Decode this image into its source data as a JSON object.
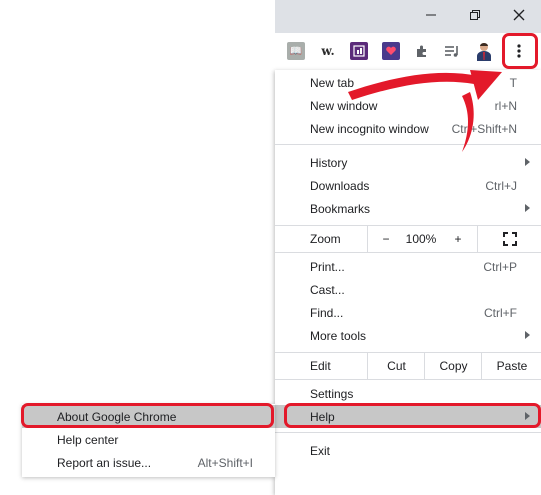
{
  "window_controls": [
    "minimize-icon",
    "restore-icon",
    "close-icon"
  ],
  "extensions": {
    "w_label": "w.",
    "icons": [
      "grammarly-like-icon",
      "w-extension-icon",
      "calendar-extension-icon",
      "heart-extension-icon",
      "puzzle-extensions-icon",
      "media-queue-icon",
      "profile-avatar-icon",
      "kebab-menu-icon"
    ]
  },
  "menu": {
    "new_tab": {
      "label": "New tab",
      "shortcut": "T"
    },
    "new_window": {
      "label": "New window",
      "shortcut": "rl+N"
    },
    "new_incognito": {
      "label": "New incognito window",
      "shortcut": "Ctrl+Shift+N"
    },
    "history": {
      "label": "History"
    },
    "downloads": {
      "label": "Downloads",
      "shortcut": "Ctrl+J"
    },
    "bookmarks": {
      "label": "Bookmarks"
    },
    "zoom": {
      "label": "Zoom",
      "minus": "−",
      "value": "100%",
      "plus": "+"
    },
    "print": {
      "label": "Print...",
      "shortcut": "Ctrl+P"
    },
    "cast": {
      "label": "Cast..."
    },
    "find": {
      "label": "Find...",
      "shortcut": "Ctrl+F"
    },
    "more_tools": {
      "label": "More tools"
    },
    "edit": {
      "label": "Edit",
      "cut": "Cut",
      "copy": "Copy",
      "paste": "Paste"
    },
    "settings": {
      "label": "Settings"
    },
    "help": {
      "label": "Help"
    },
    "exit": {
      "label": "Exit"
    }
  },
  "submenu": {
    "about": {
      "label": "About Google Chrome"
    },
    "help_center": {
      "label": "Help center"
    },
    "report": {
      "label": "Report an issue...",
      "shortcut": "Alt+Shift+I"
    }
  },
  "colors": {
    "highlight_red": "#e3192a",
    "hover_gray": "#c7c7c7",
    "titlebar": "#dee1e6"
  }
}
